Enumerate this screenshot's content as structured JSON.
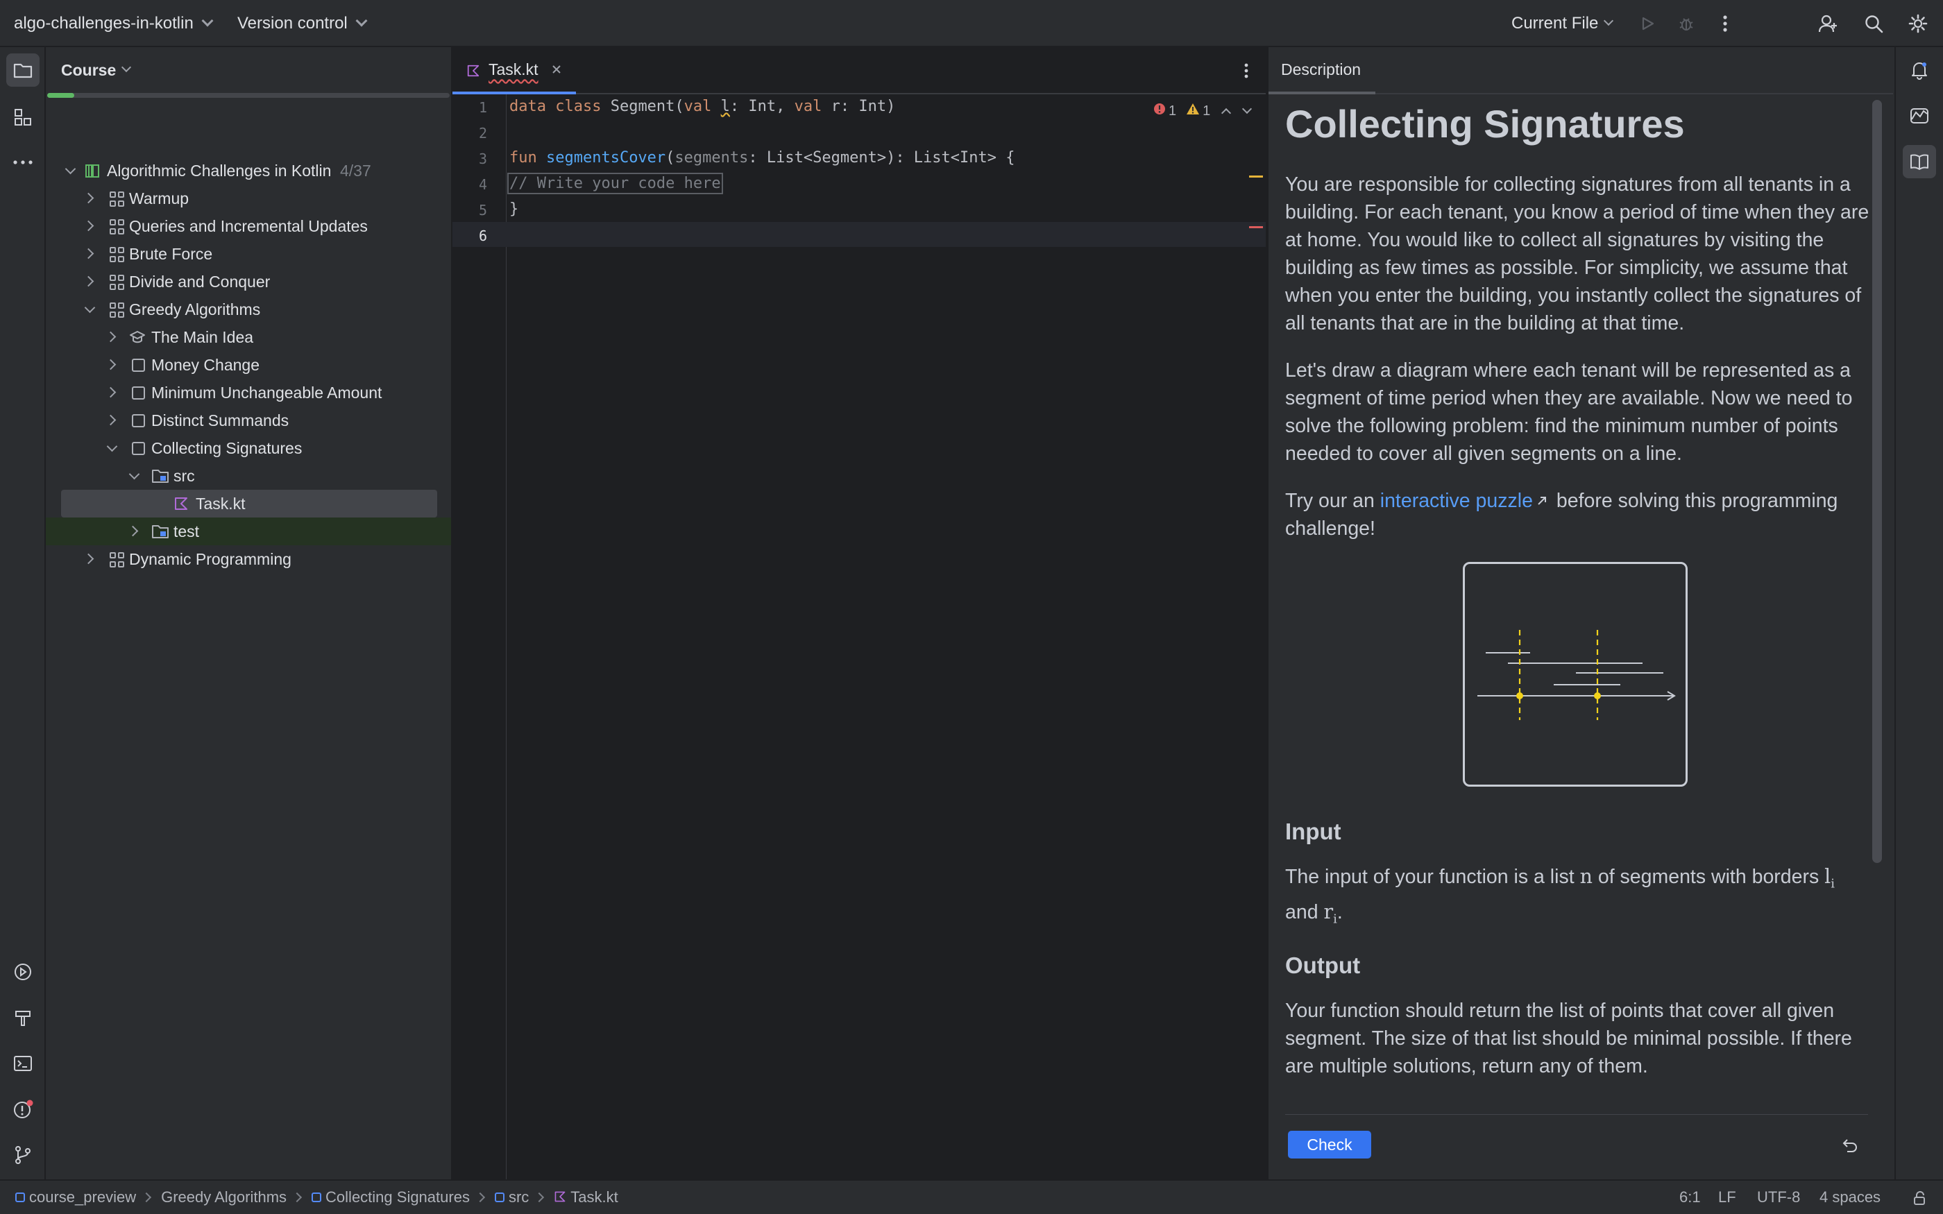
{
  "titlebar": {
    "project_name": "algo-challenges-in-kotlin",
    "vcs_label": "Version control",
    "run_config": "Current File"
  },
  "project_panel": {
    "title": "Course",
    "progress_fraction": 0.0676,
    "root": {
      "label": "Algorithmic Challenges in Kotlin",
      "count": "4/37"
    },
    "items": [
      {
        "label": "Warmup"
      },
      {
        "label": "Queries and Incremental Updates"
      },
      {
        "label": "Brute Force"
      },
      {
        "label": "Divide and Conquer"
      },
      {
        "label": "Greedy Algorithms"
      },
      {
        "label": "The Main Idea"
      },
      {
        "label": "Money Change"
      },
      {
        "label": "Minimum Unchangeable Amount"
      },
      {
        "label": "Distinct Summands"
      },
      {
        "label": "Collecting Signatures"
      },
      {
        "label": "src"
      },
      {
        "label": "Task.kt"
      },
      {
        "label": "test"
      },
      {
        "label": "Dynamic Programming"
      }
    ]
  },
  "editor": {
    "tab_label": "Task.kt",
    "errors": "1",
    "warnings": "1",
    "line_numbers": [
      "1",
      "2",
      "3",
      "4",
      "5",
      "6"
    ],
    "code": {
      "l1_kw1": "data class ",
      "l1_name": "Segment(",
      "l1_kw2": "val ",
      "l1_p1": "l",
      "l1_t1": ": Int, ",
      "l1_kw3": "val ",
      "l1_p2": "r",
      "l1_t2": ": Int)",
      "l3_kw": "fun ",
      "l3_fn": "segmentsCover",
      "l3_open": "(",
      "l3_param": "segments",
      "l3_rest": ": List<Segment>): List<Int> {",
      "l4_comment": "// Write your code here",
      "l5": "}"
    }
  },
  "description": {
    "tab_label": "Description",
    "title": "Collecting Signatures",
    "para1": "You are responsible for collecting signatures from all tenants in a building. For each tenant, you know a period of time when they are at home. You would like to collect all signatures by visiting the building as few times as possible. For simplicity, we assume that when you enter the building, you instantly collect the signatures of all tenants that are in the building at that time.",
    "para2": "Let's draw a diagram where each tenant will be represented as a segment of time period when they are available. Now we need to solve the following problem: find the minimum number of points needed to cover all given segments on a line.",
    "para3_pre": "Try our an ",
    "para3_link": "interactive puzzle",
    "para3_post": " before solving this programming challenge!",
    "input_heading": "Input",
    "input_pre": "The input of your function is a list ",
    "input_n": "n",
    "input_mid": " of segments with borders ",
    "input_l": "l",
    "input_i1": "i",
    "input_and": "and ",
    "input_r": "r",
    "input_i2": "i",
    "input_end": ".",
    "output_heading": "Output",
    "output_text": "Your function should return the list of points that cover all given segment. The size of that list should be minimal possible. If there are multiple solutions, return any of them.",
    "check_label": "Check"
  },
  "statusbar": {
    "crumbs": [
      "course_preview",
      "Greedy Algorithms",
      "Collecting Signatures",
      "src",
      "Task.kt"
    ],
    "position": "6:1",
    "line_sep": "LF",
    "encoding": "UTF-8",
    "indent": "4 spaces"
  },
  "colors": {
    "accent": "#548af7",
    "progress": "#5fb865",
    "error": "#db5c5c",
    "warning": "#e5b33a",
    "diagram_point": "#f2d21b"
  }
}
